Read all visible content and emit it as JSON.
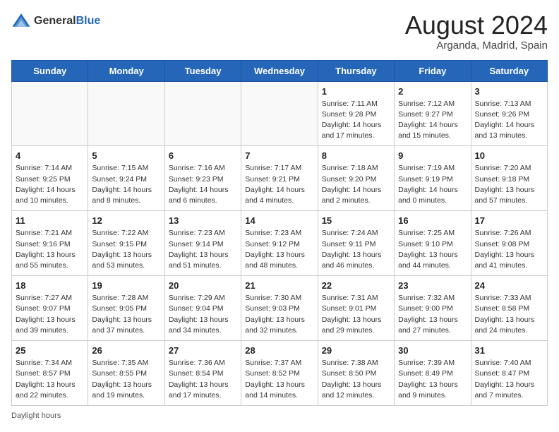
{
  "logo": {
    "general": "General",
    "blue": "Blue"
  },
  "calendar": {
    "title": "August 2024",
    "subtitle": "Arganda, Madrid, Spain",
    "days_of_week": [
      "Sunday",
      "Monday",
      "Tuesday",
      "Wednesday",
      "Thursday",
      "Friday",
      "Saturday"
    ],
    "weeks": [
      [
        {
          "day": "",
          "info": ""
        },
        {
          "day": "",
          "info": ""
        },
        {
          "day": "",
          "info": ""
        },
        {
          "day": "",
          "info": ""
        },
        {
          "day": "1",
          "info": "Sunrise: 7:11 AM\nSunset: 9:28 PM\nDaylight: 14 hours\nand 17 minutes."
        },
        {
          "day": "2",
          "info": "Sunrise: 7:12 AM\nSunset: 9:27 PM\nDaylight: 14 hours\nand 15 minutes."
        },
        {
          "day": "3",
          "info": "Sunrise: 7:13 AM\nSunset: 9:26 PM\nDaylight: 14 hours\nand 13 minutes."
        }
      ],
      [
        {
          "day": "4",
          "info": "Sunrise: 7:14 AM\nSunset: 9:25 PM\nDaylight: 14 hours\nand 10 minutes."
        },
        {
          "day": "5",
          "info": "Sunrise: 7:15 AM\nSunset: 9:24 PM\nDaylight: 14 hours\nand 8 minutes."
        },
        {
          "day": "6",
          "info": "Sunrise: 7:16 AM\nSunset: 9:23 PM\nDaylight: 14 hours\nand 6 minutes."
        },
        {
          "day": "7",
          "info": "Sunrise: 7:17 AM\nSunset: 9:21 PM\nDaylight: 14 hours\nand 4 minutes."
        },
        {
          "day": "8",
          "info": "Sunrise: 7:18 AM\nSunset: 9:20 PM\nDaylight: 14 hours\nand 2 minutes."
        },
        {
          "day": "9",
          "info": "Sunrise: 7:19 AM\nSunset: 9:19 PM\nDaylight: 14 hours\nand 0 minutes."
        },
        {
          "day": "10",
          "info": "Sunrise: 7:20 AM\nSunset: 9:18 PM\nDaylight: 13 hours\nand 57 minutes."
        }
      ],
      [
        {
          "day": "11",
          "info": "Sunrise: 7:21 AM\nSunset: 9:16 PM\nDaylight: 13 hours\nand 55 minutes."
        },
        {
          "day": "12",
          "info": "Sunrise: 7:22 AM\nSunset: 9:15 PM\nDaylight: 13 hours\nand 53 minutes."
        },
        {
          "day": "13",
          "info": "Sunrise: 7:23 AM\nSunset: 9:14 PM\nDaylight: 13 hours\nand 51 minutes."
        },
        {
          "day": "14",
          "info": "Sunrise: 7:23 AM\nSunset: 9:12 PM\nDaylight: 13 hours\nand 48 minutes."
        },
        {
          "day": "15",
          "info": "Sunrise: 7:24 AM\nSunset: 9:11 PM\nDaylight: 13 hours\nand 46 minutes."
        },
        {
          "day": "16",
          "info": "Sunrise: 7:25 AM\nSunset: 9:10 PM\nDaylight: 13 hours\nand 44 minutes."
        },
        {
          "day": "17",
          "info": "Sunrise: 7:26 AM\nSunset: 9:08 PM\nDaylight: 13 hours\nand 41 minutes."
        }
      ],
      [
        {
          "day": "18",
          "info": "Sunrise: 7:27 AM\nSunset: 9:07 PM\nDaylight: 13 hours\nand 39 minutes."
        },
        {
          "day": "19",
          "info": "Sunrise: 7:28 AM\nSunset: 9:05 PM\nDaylight: 13 hours\nand 37 minutes."
        },
        {
          "day": "20",
          "info": "Sunrise: 7:29 AM\nSunset: 9:04 PM\nDaylight: 13 hours\nand 34 minutes."
        },
        {
          "day": "21",
          "info": "Sunrise: 7:30 AM\nSunset: 9:03 PM\nDaylight: 13 hours\nand 32 minutes."
        },
        {
          "day": "22",
          "info": "Sunrise: 7:31 AM\nSunset: 9:01 PM\nDaylight: 13 hours\nand 29 minutes."
        },
        {
          "day": "23",
          "info": "Sunrise: 7:32 AM\nSunset: 9:00 PM\nDaylight: 13 hours\nand 27 minutes."
        },
        {
          "day": "24",
          "info": "Sunrise: 7:33 AM\nSunset: 8:58 PM\nDaylight: 13 hours\nand 24 minutes."
        }
      ],
      [
        {
          "day": "25",
          "info": "Sunrise: 7:34 AM\nSunset: 8:57 PM\nDaylight: 13 hours\nand 22 minutes."
        },
        {
          "day": "26",
          "info": "Sunrise: 7:35 AM\nSunset: 8:55 PM\nDaylight: 13 hours\nand 19 minutes."
        },
        {
          "day": "27",
          "info": "Sunrise: 7:36 AM\nSunset: 8:54 PM\nDaylight: 13 hours\nand 17 minutes."
        },
        {
          "day": "28",
          "info": "Sunrise: 7:37 AM\nSunset: 8:52 PM\nDaylight: 13 hours\nand 14 minutes."
        },
        {
          "day": "29",
          "info": "Sunrise: 7:38 AM\nSunset: 8:50 PM\nDaylight: 13 hours\nand 12 minutes."
        },
        {
          "day": "30",
          "info": "Sunrise: 7:39 AM\nSunset: 8:49 PM\nDaylight: 13 hours\nand 9 minutes."
        },
        {
          "day": "31",
          "info": "Sunrise: 7:40 AM\nSunset: 8:47 PM\nDaylight: 13 hours\nand 7 minutes."
        }
      ]
    ]
  },
  "footer": {
    "note": "Daylight hours"
  }
}
